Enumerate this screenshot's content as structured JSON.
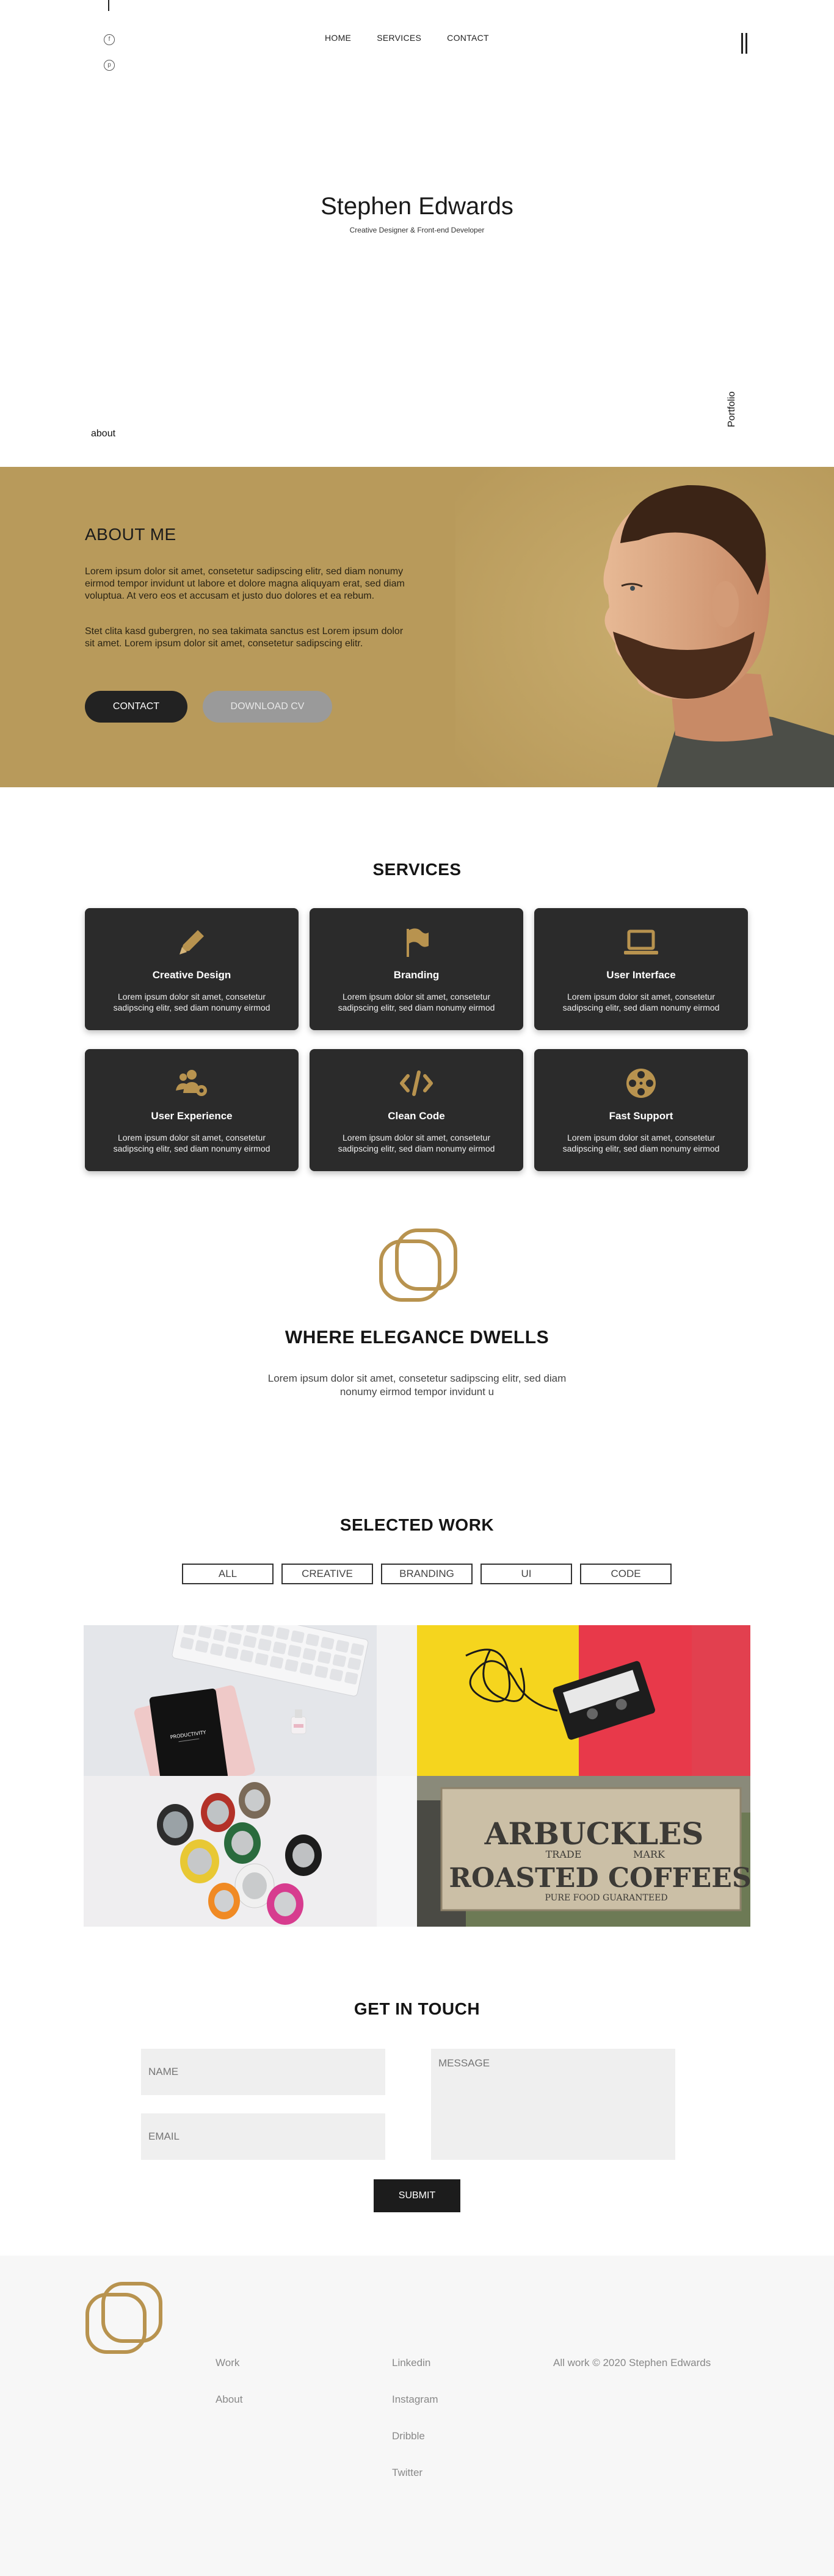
{
  "nav": {
    "items": [
      "HOME",
      "SERVICES",
      "CONTACT"
    ]
  },
  "hero": {
    "title": "Stephen Edwards",
    "subtitle": "Creative Designer & Front-end Developer",
    "about_link": "about",
    "portfolio_link": "Portfolio",
    "social_icons": [
      "facebook-icon",
      "pinterest-icon"
    ]
  },
  "about": {
    "title": "ABOUT ME",
    "p1": "Lorem ipsum dolor sit amet, consetetur sadipscing elitr, sed diam nonumy eirmod tempor invidunt ut labore et dolore magna aliquyam erat, sed diam voluptua. At vero eos et accusam et justo duo dolores et ea rebum.",
    "p2": "Stet clita kasd gubergren, no sea takimata sanctus est Lorem ipsum dolor sit amet. Lorem ipsum dolor sit amet, consetetur sadipscing elitr.",
    "contact_button": "CONTACT",
    "cv_button": "DOWNLOAD CV",
    "background_color": "#b89a5b"
  },
  "services": {
    "title": "SERVICES",
    "accent_color": "#b8934f",
    "cards": [
      {
        "title": "Creative Design",
        "desc": "Lorem ipsum dolor sit amet, consetetur sadipscing elitr, sed diam nonumy eirmod",
        "icon": "pencil-icon"
      },
      {
        "title": "Branding",
        "desc": "Lorem ipsum dolor sit amet, consetetur sadipscing elitr, sed diam nonumy eirmod",
        "icon": "flag-icon"
      },
      {
        "title": "User Interface",
        "desc": "Lorem ipsum dolor sit amet, consetetur sadipscing elitr, sed diam nonumy eirmod",
        "icon": "laptop-icon"
      },
      {
        "title": "User Experience",
        "desc": "Lorem ipsum dolor sit amet, consetetur sadipscing elitr, sed diam nonumy eirmod",
        "icon": "users-cog-icon"
      },
      {
        "title": "Clean Code",
        "desc": "Lorem ipsum dolor sit amet, consetetur sadipscing elitr, sed diam nonumy eirmod",
        "icon": "code-icon"
      },
      {
        "title": "Fast Support",
        "desc": "Lorem ipsum dolor sit amet, consetetur sadipscing elitr, sed diam nonumy eirmod",
        "icon": "film-reel-icon"
      }
    ]
  },
  "elegance": {
    "title": "WHERE ELEGANCE DWELLS",
    "text": "Lorem ipsum dolor sit amet, consetetur sadipscing elitr, sed diam nonumy eirmod tempor invidunt u"
  },
  "work": {
    "title": "SELECTED WORK",
    "filters": [
      "ALL",
      "CREATIVE",
      "BRANDING",
      "UI",
      "CODE"
    ],
    "tiles": [
      {
        "alt": "productivity notebook and keyboard",
        "caption": "PRODUCTIVITY"
      },
      {
        "alt": "cassette tape on yellow and red"
      },
      {
        "alt": "colourful drink cans"
      },
      {
        "alt": "Arbuckles roasted coffees crate",
        "crate_line1": "ARBUCKLES",
        "crate_line2": "TRADE",
        "crate_line3": "MARK",
        "crate_line4": "ROASTED COFFEES",
        "crate_line5": "PURE FOOD GUARANTEED"
      }
    ]
  },
  "contact": {
    "title": "GET IN TOUCH",
    "name_placeholder": "NAME",
    "email_placeholder": "EMAIL",
    "message_placeholder": "MESSAGE",
    "submit_label": "SUBMIT"
  },
  "footer": {
    "col1": [
      "Work",
      "About"
    ],
    "col2": [
      "Linkedin",
      "Instagram",
      "Dribble",
      "Twitter"
    ],
    "copyright": "All work © 2020 Stephen Edwards"
  }
}
